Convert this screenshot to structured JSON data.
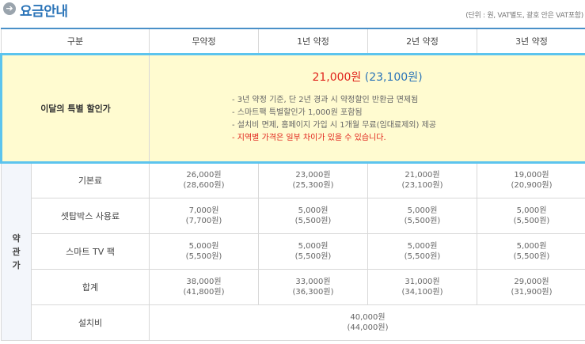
{
  "header": {
    "title": "요금안내",
    "unit_note": "(단위 : 원, VAT별도, 괄호 안은 VAT포함)"
  },
  "columns": [
    "구분",
    "무약정",
    "1년 약정",
    "2년 약정",
    "3년 약정"
  ],
  "special": {
    "label": "이달의 특별 할인가",
    "price_main": "21,000원",
    "price_sub": "(23,100원)",
    "notes": [
      "- 3년 약정 기준, 단 2년 경과 시 약정할인 반환금 면제됨",
      "- 스마트팩 특별할인가 1,000원 포함됨",
      "- 설치비 면제, 홈페이지 가입 시 1개월 무료(임대료제외) 제공",
      "- 지역별 가격은 일부 차이가 있을 수 있습니다."
    ]
  },
  "group_label": "약\n관\n가",
  "rows": [
    {
      "label": "기본료",
      "values": [
        [
          "26,000원",
          "(28,600원)"
        ],
        [
          "23,000원",
          "(25,300원)"
        ],
        [
          "21,000원",
          "(23,100원)"
        ],
        [
          "19,000원",
          "(20,900원)"
        ]
      ]
    },
    {
      "label": "셋탑박스 사용료",
      "values": [
        [
          "7,000원",
          "(7,700원)"
        ],
        [
          "5,000원",
          "(5,500원)"
        ],
        [
          "5,000원",
          "(5,500원)"
        ],
        [
          "5,000원",
          "(5,500원)"
        ]
      ]
    },
    {
      "label": "스마트 TV 팩",
      "values": [
        [
          "5,000원",
          "(5,500원)"
        ],
        [
          "5,000원",
          "(5,500원)"
        ],
        [
          "5,000원",
          "(5,500원)"
        ],
        [
          "5,000원",
          "(5,500원)"
        ]
      ]
    },
    {
      "label": "합계",
      "values": [
        [
          "38,000원",
          "(41,800원)"
        ],
        [
          "33,000원",
          "(36,300원)"
        ],
        [
          "31,000원",
          "(34,100원)"
        ],
        [
          "29,000원",
          "(31,900원)"
        ]
      ]
    }
  ],
  "install": {
    "label": "설치비",
    "value": "40,000원",
    "value_vat": "(44,000원)"
  },
  "colors": {
    "accent_blue": "#2b74b8",
    "highlight_border": "#5cc4ee",
    "highlight_bg": "#fffbd0",
    "red": "#e0231b"
  }
}
